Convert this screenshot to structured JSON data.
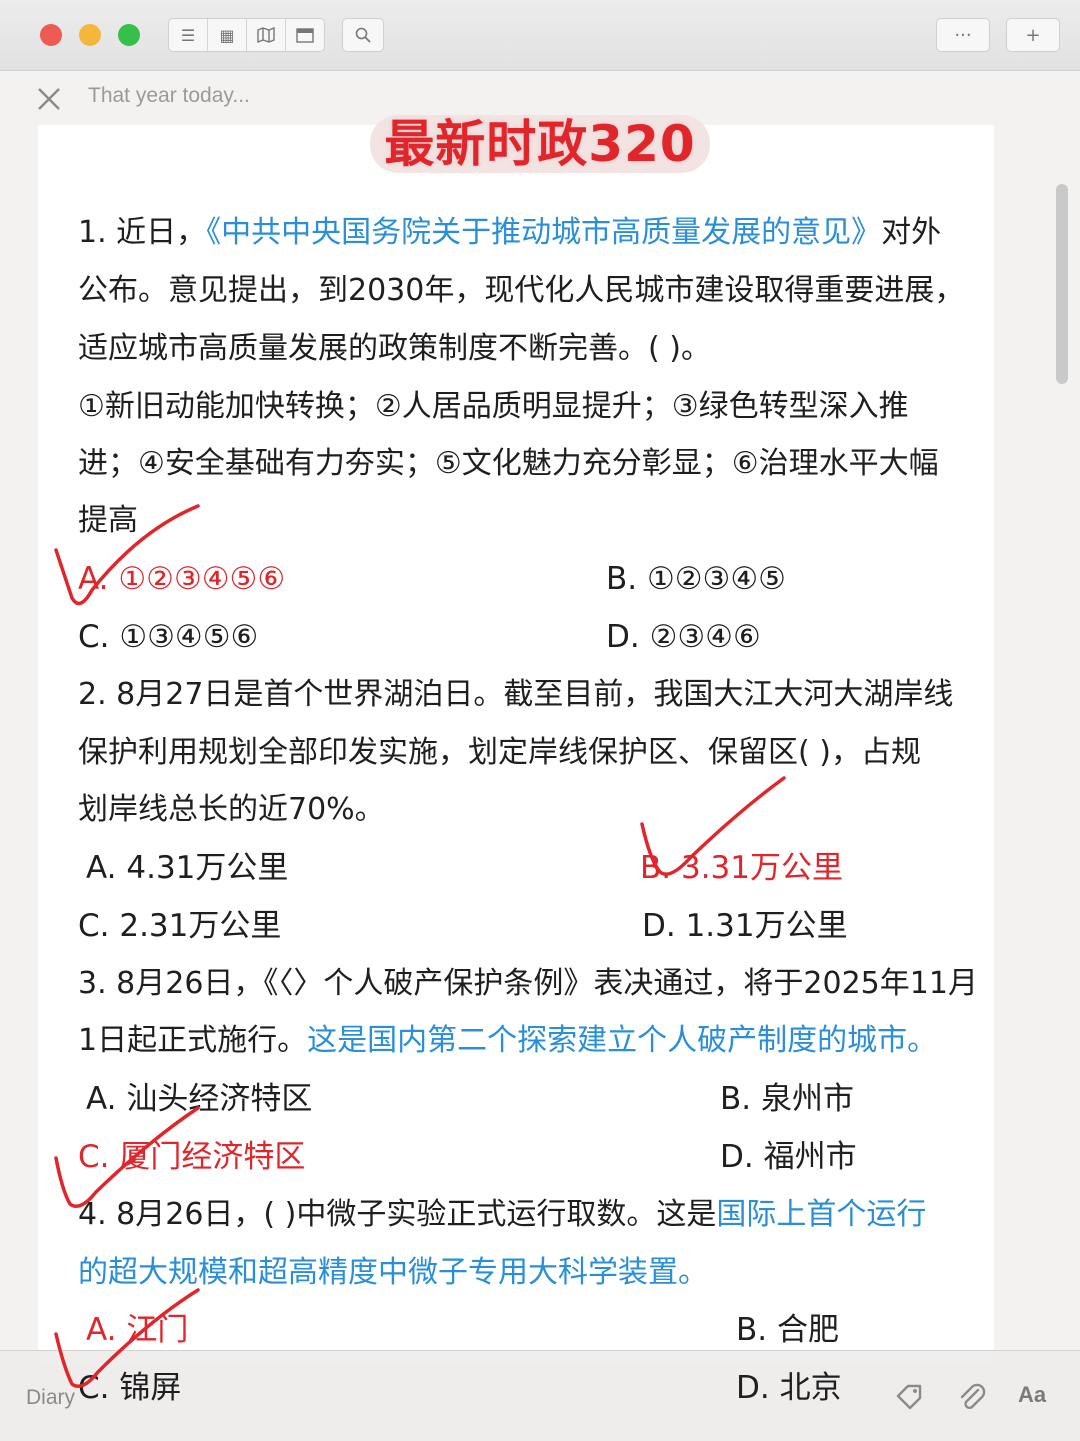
{
  "window": {
    "hint": "That year today...",
    "diary_label": "Diary",
    "font_button": "Aa"
  },
  "doc": {
    "title": "最新时政320",
    "q1": {
      "l1_a": "1. 近日，",
      "l1_b": "《中共中央国务院关于推动城市高质量发展的意见》",
      "l1_c": "对外",
      "l2": "公布。意见提出，到2030年，现代化人民城市建设取得重要进展，",
      "l3": "适应城市高质量发展的政策制度不断完善。(    )。",
      "l4": "①新旧动能加快转换；②人居品质明显提升；③绿色转型深入推",
      "l5": "进；④安全基础有力夯实；⑤文化魅力充分彰显；⑥治理水平大幅",
      "l6": "提高",
      "opt_a": "A. ①②③④⑤⑥",
      "opt_b": "B. ①②③④⑤",
      "opt_c": "C. ①③④⑤⑥",
      "opt_d": "D. ②③④⑥"
    },
    "q2": {
      "l1": "2. 8月27日是首个世界湖泊日。截至目前，我国大江大河大湖岸线",
      "l2": "保护利用规划全部印发实施，划定岸线保护区、保留区(     )，占规",
      "l3": "划岸线总长的近70%。",
      "opt_a": "A. 4.31万公里",
      "opt_b": "B. 3.31万公里",
      "opt_c": "C. 2.31万公里",
      "opt_d": "D. 1.31万公里"
    },
    "q3": {
      "l1": "3. 8月26日，《〈〉个人破产保护条例》表决通过，将于2025年11月",
      "l2_a": "1日起正式施行。",
      "l2_b": "这是国内第二个探索建立个人破产制度的城市。",
      "opt_a": "A. 汕头经济特区",
      "opt_b": "B. 泉州市",
      "opt_c": "C. 厦门经济特区",
      "opt_d": "D. 福州市"
    },
    "q4": {
      "l1_a": "4. 8月26日，(     )中微子实验正式运行取数。这是",
      "l1_b": "国际上首个运行",
      "l2": "的超大规模和超高精度中微子专用大科学装置。",
      "opt_a": "A. 江门",
      "opt_b": "B. 合肥",
      "opt_c": "C. 锦屏",
      "opt_d": "D. 北京"
    }
  },
  "colors": {
    "answer_red": "#e0262b",
    "highlight_blue": "#2a8fd8",
    "text": "#1f1f1f"
  }
}
